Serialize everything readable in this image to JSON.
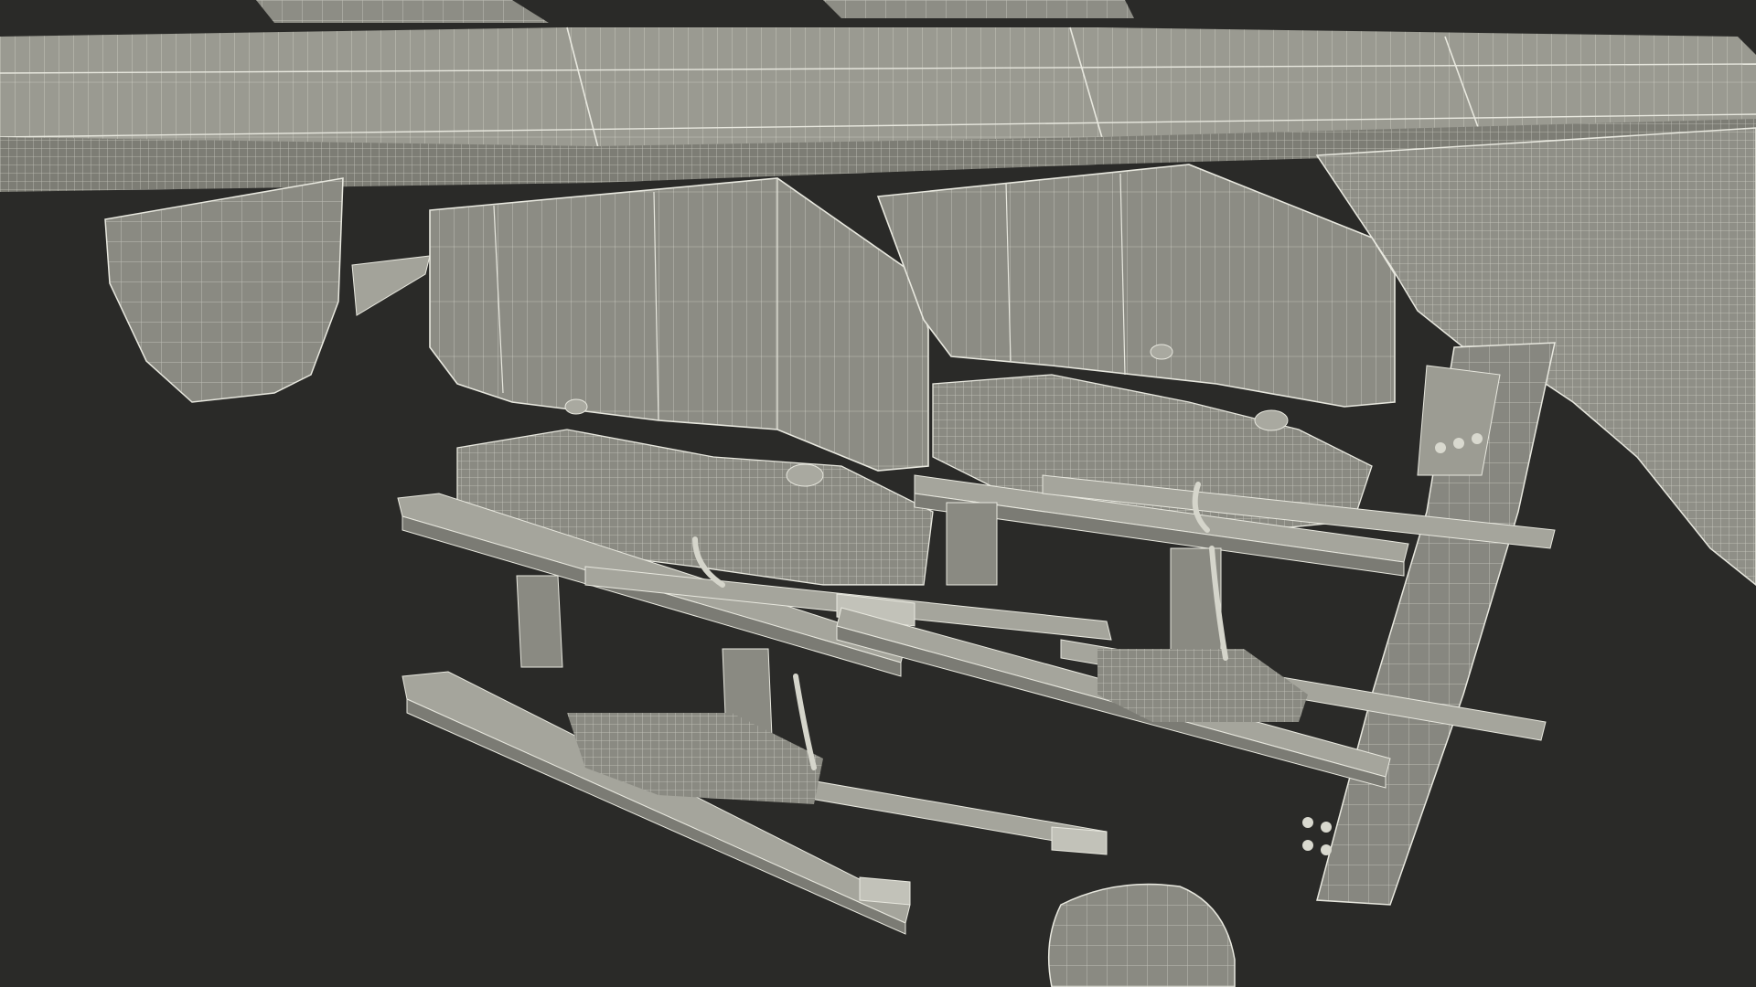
{
  "scene": {
    "subject": "wireframe-render",
    "colors": {
      "background": "#2a2a28",
      "surface": "#8f8f87",
      "surface_light": "#a9a9a0",
      "surface_dark": "#6f6f68",
      "wire": "#e8e8df",
      "wire_dense": "#f2f2ea"
    }
  }
}
